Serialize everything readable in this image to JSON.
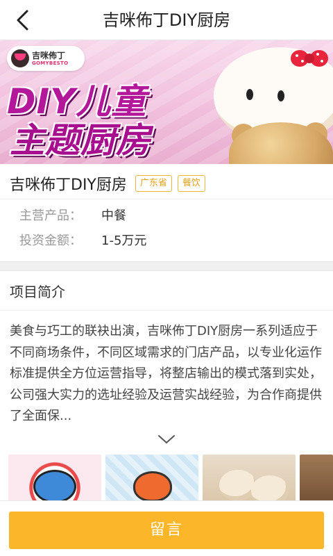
{
  "header": {
    "title": "吉咪佈丁DIY厨房",
    "back_icon": "chevron-left-icon"
  },
  "banner": {
    "logo_cn": "吉咪佈丁",
    "logo_en": "GOMYBESTO",
    "headline_line1": "DIY儿童",
    "headline_line2": "主题厨房"
  },
  "info": {
    "name": "吉咪佈丁DIY厨房",
    "tags": [
      "广东省",
      "餐饮"
    ],
    "fields": [
      {
        "label": "主营产品：",
        "value": "中餐"
      },
      {
        "label": "投资金额：",
        "value": "1-5万元"
      }
    ]
  },
  "intro": {
    "title": "项目简介",
    "text": "美食与巧工的联袂出演，吉咪佈丁DIY厨房一系列适应于不同商场条件，不同区域需求的门店产品，以专业化运作标准提供全方位运营指导，将整店输出的模式落到实处，公司强大实力的选址经验及运营实战经验，为合作商提供了全面保...",
    "expand_icon": "chevron-down-icon"
  },
  "footer": {
    "message_button": "留言"
  },
  "colors": {
    "accent": "#fbb629",
    "tag_border": "#f3b533",
    "banner_text": "#b3179a"
  }
}
